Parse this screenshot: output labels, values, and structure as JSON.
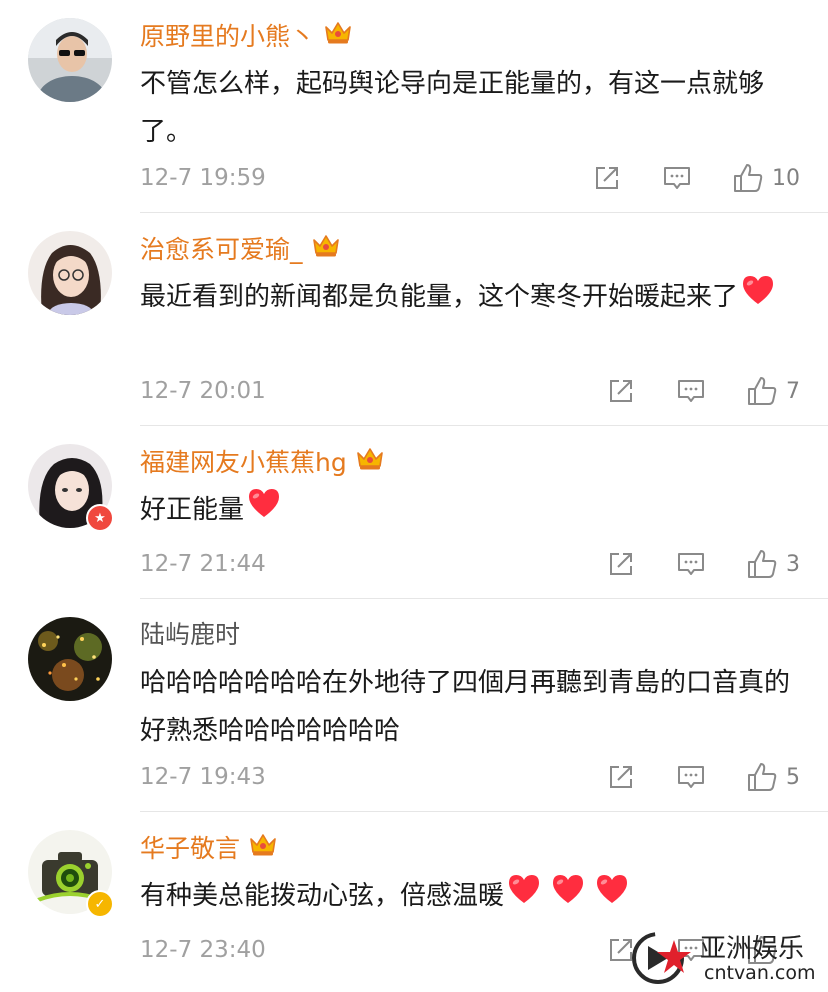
{
  "colors": {
    "vip_name": "#e57a1f",
    "normal_name": "#555555",
    "time": "#a0a0a0",
    "icon": "#8a8a8a",
    "heart": "#ff2d3f",
    "divider": "#e6e6e6"
  },
  "comments": [
    {
      "username": "原野里的小熊丶",
      "text": "不管怎么样，起码舆论导向是正能量的，有这一点就够了。",
      "hearts": 0,
      "time": "12-7 19:59",
      "like_count": "10",
      "vip": true
    },
    {
      "username": "治愈系可爱瑜_",
      "text": "最近看到的新闻都是负能量，这个寒冬开始暖起来了",
      "hearts": 1,
      "time": "12-7 20:01",
      "like_count": "7",
      "vip": true
    },
    {
      "username": "福建网友小蕉蕉hg",
      "text": "好正能量",
      "hearts": 1,
      "time": "12-7 21:44",
      "like_count": "3",
      "vip": true
    },
    {
      "username": "陆屿鹿时",
      "text": "哈哈哈哈哈哈哈在外地待了四個月再聽到青島的口音真的好熟悉哈哈哈哈哈哈哈",
      "hearts": 0,
      "time": "12-7 19:43",
      "like_count": "5",
      "vip": false
    },
    {
      "username": "华子敬言",
      "text": "有种美总能拨动心弦，倍感温暖",
      "hearts": 3,
      "time": "12-7 23:40",
      "like_count": "",
      "vip": true
    }
  ],
  "icons": {
    "share": "share-icon",
    "reply": "comment-icon",
    "like": "thumbs-up-icon",
    "crown": "vip-crown-icon"
  },
  "watermark": {
    "title": "亚洲娱乐",
    "subtitle": "cntvan.com"
  }
}
